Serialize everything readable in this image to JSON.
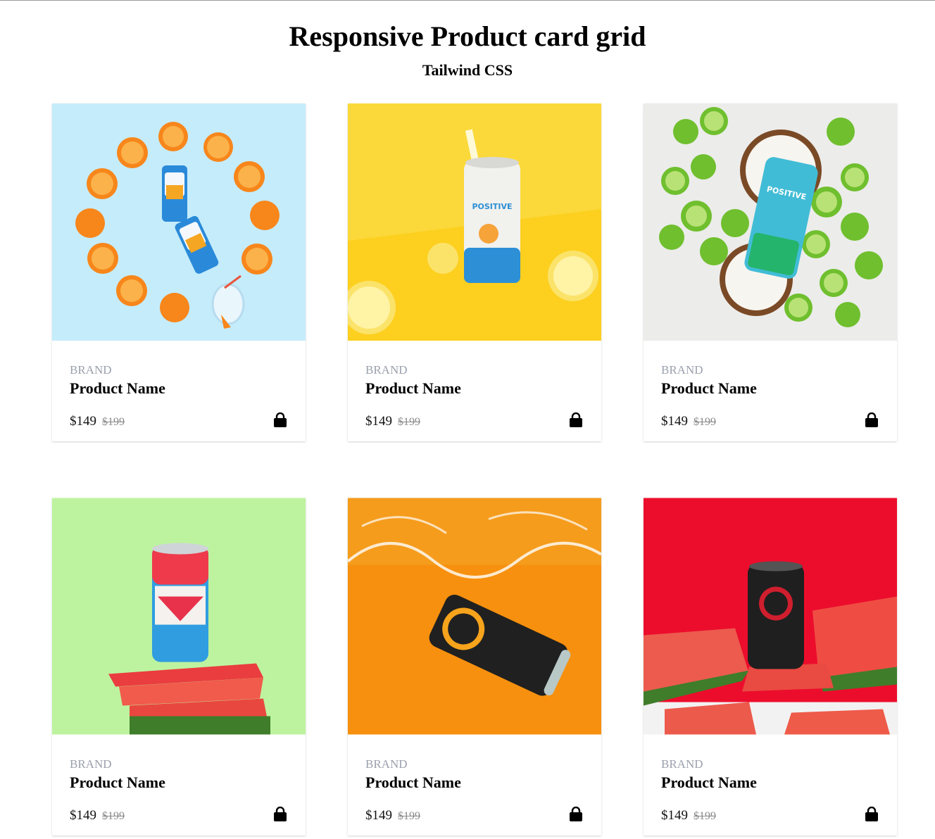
{
  "header": {
    "title": "Responsive Product card grid",
    "subtitle": "Tailwind CSS"
  },
  "products": [
    {
      "brand": "Brand",
      "name": "Product Name",
      "price": "$149",
      "old_price": "$199",
      "image": "orange-clock-cans",
      "bg": "#c5ecfb",
      "icon": "shopping-bag-icon"
    },
    {
      "brand": "Brand",
      "name": "Product Name",
      "price": "$149",
      "old_price": "$199",
      "image": "lemon-can",
      "bg": "#fbd93a",
      "icon": "shopping-bag-icon"
    },
    {
      "brand": "Brand",
      "name": "Product Name",
      "price": "$149",
      "old_price": "$199",
      "image": "lime-coconut-can",
      "bg": "#ececea",
      "icon": "shopping-bag-icon"
    },
    {
      "brand": "Brand",
      "name": "Product Name",
      "price": "$149",
      "old_price": "$199",
      "image": "watermelon-stack-can",
      "bg": "#bdf39f",
      "icon": "shopping-bag-icon"
    },
    {
      "brand": "Brand",
      "name": "Product Name",
      "price": "$149",
      "old_price": "$199",
      "image": "splash-can",
      "bg": "#f7900e",
      "icon": "shopping-bag-icon"
    },
    {
      "brand": "Brand",
      "name": "Product Name",
      "price": "$149",
      "old_price": "$199",
      "image": "watermelon-red-can",
      "bg": "#ec0d2c",
      "icon": "shopping-bag-icon"
    }
  ]
}
